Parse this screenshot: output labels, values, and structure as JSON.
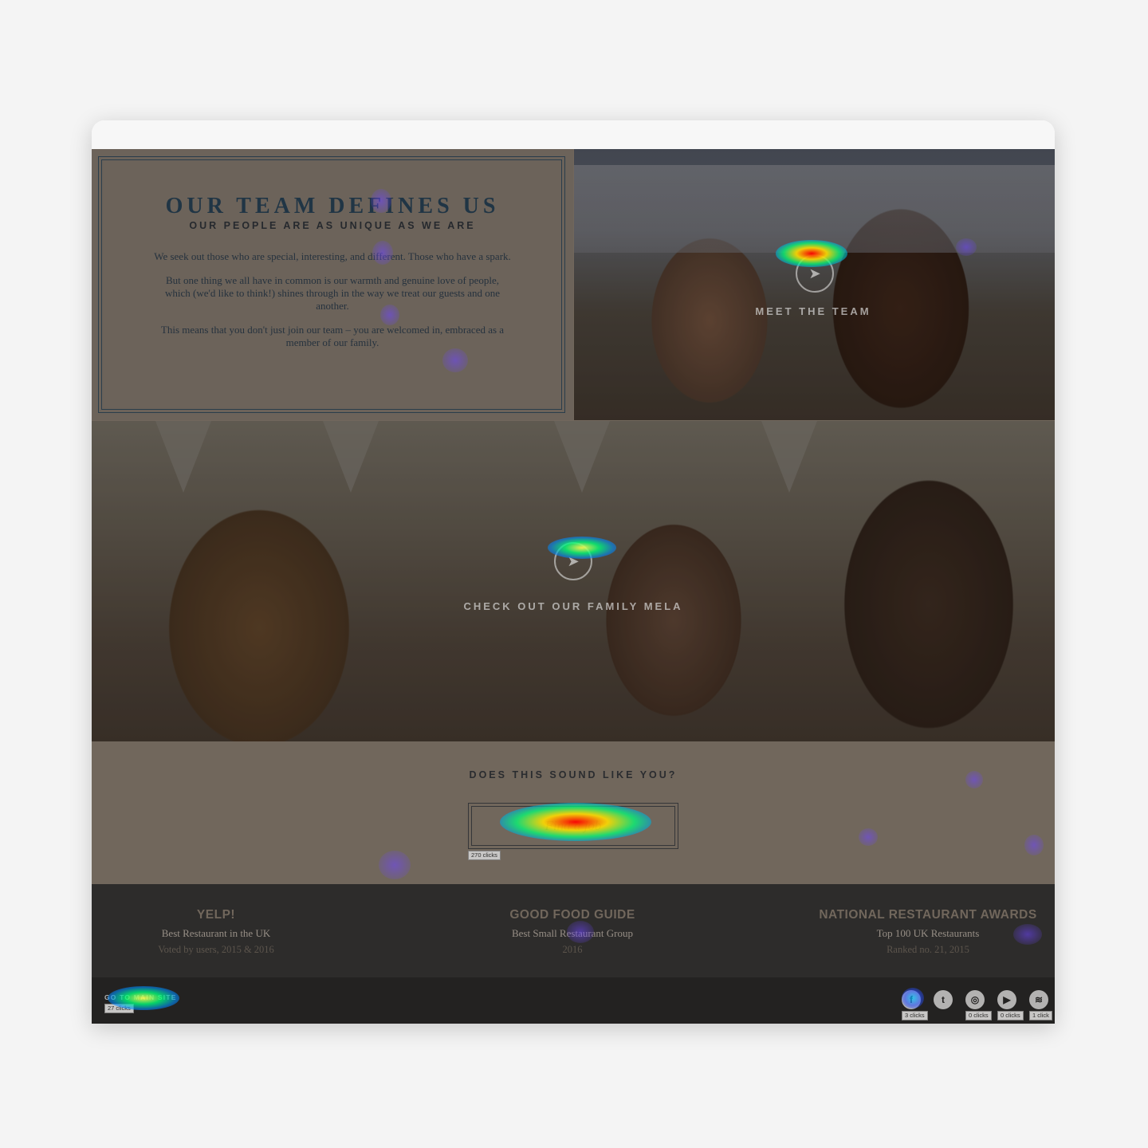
{
  "intro": {
    "title": "OUR TEAM DEFINES US",
    "subtitle": "OUR PEOPLE ARE AS UNIQUE AS WE ARE",
    "paragraphs": [
      "We seek out those who are special, interesting, and different. Those who have a spark.",
      "But one thing we all have in common is our warmth and genuine love of people, which (we'd like to think!) shines through in the way we treat our guests and one another.",
      "This means that you don't just join our team – you are welcomed in, embraced as a member of our family."
    ]
  },
  "panels": {
    "meet_team": "MEET THE TEAM",
    "family_mela": "CHECK OUT OUR FAMILY MELA"
  },
  "cta": {
    "question": "DOES THIS SOUND LIKE YOU?",
    "button": "Find a job",
    "button_clicks": "270 clicks"
  },
  "awards": [
    {
      "title": "YELP!",
      "line1": "Best Restaurant in the UK",
      "line2": "Voted by users, 2015 & 2016"
    },
    {
      "title": "GOOD FOOD GUIDE",
      "line1": "Best Small Restaurant Group",
      "line2": "2016"
    },
    {
      "title": "NATIONAL RESTAURANT AWARDS",
      "line1": "Top 100 UK Restaurants",
      "line2": "Ranked no. 21, 2015"
    }
  ],
  "footer": {
    "main_site": "GO TO MAIN SITE",
    "main_site_clicks": "27 clicks",
    "social": [
      {
        "icon": "facebook-icon",
        "glyph": "f",
        "clicks": "3 clicks"
      },
      {
        "icon": "twitter-icon",
        "glyph": "t",
        "clicks": ""
      },
      {
        "icon": "instagram-icon",
        "glyph": "◎",
        "clicks": "0 clicks"
      },
      {
        "icon": "youtube-icon",
        "glyph": "▶",
        "clicks": "0 clicks"
      },
      {
        "icon": "spotify-icon",
        "glyph": "≋",
        "clicks": "1 click"
      }
    ]
  },
  "colors": {
    "page_bg": "#857a6e",
    "title_blue": "#233d52",
    "awards_bg": "#323233",
    "footer_bg": "#262626"
  }
}
